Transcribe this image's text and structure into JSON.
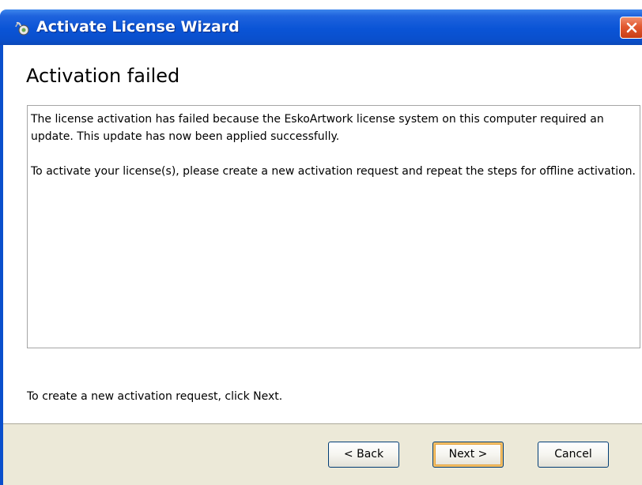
{
  "window": {
    "title": "Activate License Wizard"
  },
  "page": {
    "heading": "Activation failed",
    "message_paragraphs": [
      "The license activation has failed because the EskoArtwork license system on this computer required an update. This update has now been applied successfully.",
      "To activate your license(s), please create a new activation request and repeat the steps for offline activation."
    ],
    "hint": "To create a new activation request, click Next."
  },
  "buttons": {
    "back": "< Back",
    "next": "Next >",
    "cancel": "Cancel"
  },
  "colors": {
    "titlebar": "#0a54d6",
    "close_button": "#e2582f",
    "footer_background": "#ece9d8",
    "default_button_highlight": "#f5c065"
  },
  "icons": {
    "app_icon": "license-key-icon",
    "close_icon": "close-icon"
  }
}
